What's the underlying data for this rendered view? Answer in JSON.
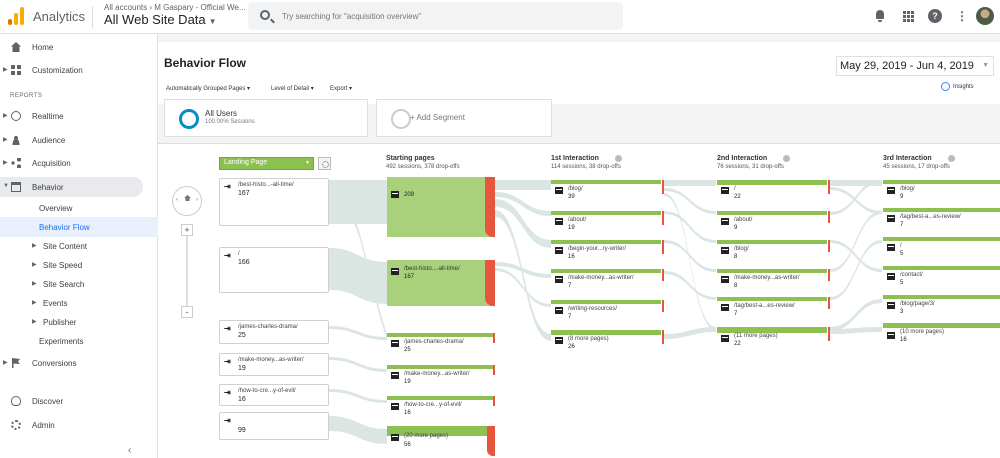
{
  "topbar": {
    "app_name": "Analytics",
    "breadcrumb": "All accounts › M Gaspary - Official We...",
    "property": "All Web Site Data",
    "search_placeholder": "Try searching for \"acquisition overview\""
  },
  "sidebar": {
    "items": [
      {
        "label": "Home",
        "icon": "home-icon"
      },
      {
        "label": "Customization",
        "icon": "dashboard-icon"
      },
      {
        "label": "REPORTS"
      },
      {
        "label": "Realtime",
        "icon": "clock-icon"
      },
      {
        "label": "Audience",
        "icon": "person-icon"
      },
      {
        "label": "Acquisition",
        "icon": "acquisition-icon"
      },
      {
        "label": "Behavior",
        "icon": "behavior-icon"
      },
      {
        "label": "Overview"
      },
      {
        "label": "Behavior Flow"
      },
      {
        "label": "Site Content"
      },
      {
        "label": "Site Speed"
      },
      {
        "label": "Site Search"
      },
      {
        "label": "Events"
      },
      {
        "label": "Publisher"
      },
      {
        "label": "Experiments"
      },
      {
        "label": "Conversions",
        "icon": "flag-icon"
      },
      {
        "label": "Discover",
        "icon": "lightbulb-icon"
      },
      {
        "label": "Admin",
        "icon": "gear-icon"
      }
    ]
  },
  "page": {
    "title": "Behavior Flow",
    "date_range": "May 29, 2019 - Jun 4, 2019",
    "tools": [
      "Automatically Grouped Pages",
      "Level of Detail",
      "Export"
    ],
    "insights": "Insights",
    "segment_name": "All Users",
    "segment_pct": "100.00% Sessions",
    "add_segment": "+ Add Segment",
    "dimension": "Landing Page"
  },
  "flow": {
    "columns": [
      {
        "title": "Starting pages",
        "stats": "492 sessions, 378 drop-offs"
      },
      {
        "title": "1st Interaction",
        "stats": "114 sessions, 38 drop-offs"
      },
      {
        "title": "2nd Interaction",
        "stats": "76 sessions, 31 drop-offs"
      },
      {
        "title": "3rd Interaction",
        "stats": "45 sessions, 17 drop-offs"
      }
    ],
    "landing": [
      {
        "name": "/best-histo...-all-time/",
        "value": "167"
      },
      {
        "name": "/",
        "value": "166"
      },
      {
        "name": "/james-charles-drama/",
        "value": "25"
      },
      {
        "name": "/make-money...as-writer/",
        "value": "19"
      },
      {
        "name": "/how-to-cre...y-of-evil/",
        "value": "16"
      },
      {
        "name": "",
        "value": "99"
      }
    ],
    "starting": [
      {
        "name": "",
        "value": "209"
      },
      {
        "name": "/best-histo...-all-time/",
        "value": "167"
      },
      {
        "name": "/james-charles-drama/",
        "value": "25"
      },
      {
        "name": "/make-money...as-writer/",
        "value": "19"
      },
      {
        "name": "/how-to-cre...y-of-evil/",
        "value": "16"
      },
      {
        "name": "(20 more pages)",
        "value": "56"
      }
    ],
    "first": [
      {
        "name": "/blog/",
        "value": "39"
      },
      {
        "name": "/about/",
        "value": "19"
      },
      {
        "name": "/begin-your...ry-writer/",
        "value": "16"
      },
      {
        "name": "/make-money...as-writer/",
        "value": "7"
      },
      {
        "name": "/writing-resources/",
        "value": "7"
      },
      {
        "name": "(8 more pages)",
        "value": "26"
      }
    ],
    "second": [
      {
        "name": "/",
        "value": "22"
      },
      {
        "name": "/about/",
        "value": "9"
      },
      {
        "name": "/blog/",
        "value": "8"
      },
      {
        "name": "/make-money...as-writer/",
        "value": "8"
      },
      {
        "name": "/tag/best-a...es-review/",
        "value": "7"
      },
      {
        "name": "(11 more pages)",
        "value": "22"
      }
    ],
    "third": [
      {
        "name": "/blog/",
        "value": "9"
      },
      {
        "name": "/tag/best-a...es-review/",
        "value": "7"
      },
      {
        "name": "/",
        "value": "5"
      },
      {
        "name": "/contact/",
        "value": "5"
      },
      {
        "name": "/blog/page/3/",
        "value": "3"
      },
      {
        "name": "(10 more pages)",
        "value": "16"
      }
    ]
  }
}
